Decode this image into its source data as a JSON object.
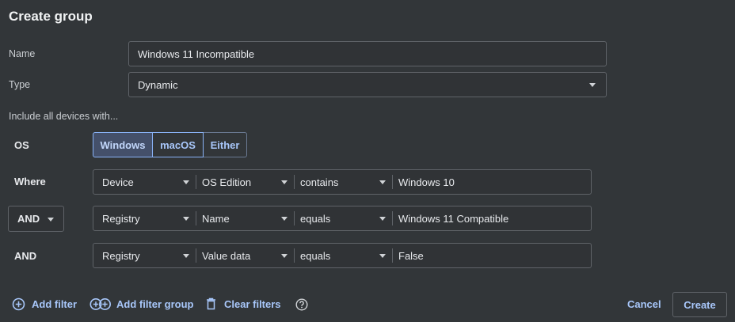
{
  "dialog": {
    "title": "Create group"
  },
  "name_field": {
    "label": "Name",
    "value": "Windows 11 Incompatible"
  },
  "type_field": {
    "label": "Type",
    "value": "Dynamic"
  },
  "include_text": "Include all devices with...",
  "os": {
    "label": "OS",
    "options": [
      "Windows",
      "macOS",
      "Either"
    ],
    "selected": "Windows"
  },
  "filters": [
    {
      "operator": "Where",
      "operator_dropdown": false,
      "category": "Device",
      "attribute": "OS Edition",
      "comparison": "contains",
      "value": "Windows 10"
    },
    {
      "operator": "AND",
      "operator_dropdown": true,
      "category": "Registry",
      "attribute": "Name",
      "comparison": "equals",
      "value": "Windows 11 Compatible"
    },
    {
      "operator": "AND",
      "operator_dropdown": false,
      "category": "Registry",
      "attribute": "Value data",
      "comparison": "equals",
      "value": "False"
    }
  ],
  "footer": {
    "add_filter": "Add filter",
    "add_filter_group": "Add filter group",
    "clear_filters": "Clear filters",
    "help_icon": "help-icon",
    "cancel": "Cancel",
    "create": "Create"
  },
  "colors": {
    "background": "#323639",
    "accent": "#a8c7fa",
    "border": "#5f6368",
    "selected_segment": "#44506a"
  }
}
